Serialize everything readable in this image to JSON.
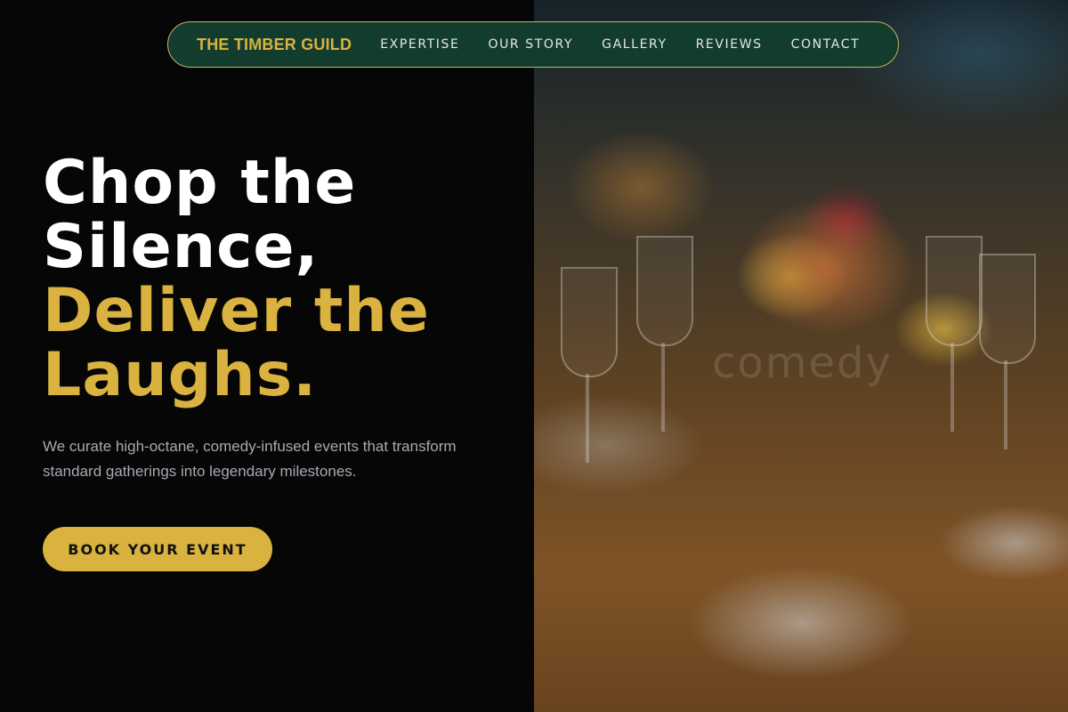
{
  "nav": {
    "brand": "THE TIMBER GUILD",
    "links": [
      "EXPERTISE",
      "OUR STORY",
      "GALLERY",
      "REVIEWS",
      "CONTACT"
    ]
  },
  "hero": {
    "headline_white_1": "Chop the",
    "headline_white_2": "Silence,",
    "headline_gold_1": "Deliver the",
    "headline_gold_2": "Laughs.",
    "subtext": "We curate high-octane, comedy-infused events that transform standard gatherings into legendary milestones.",
    "cta_label": "BOOK YOUR EVENT"
  },
  "image": {
    "watermark": "comedy"
  },
  "colors": {
    "accent_gold": "#d9b23f",
    "nav_green": "#123d2e",
    "background": "#060606"
  }
}
